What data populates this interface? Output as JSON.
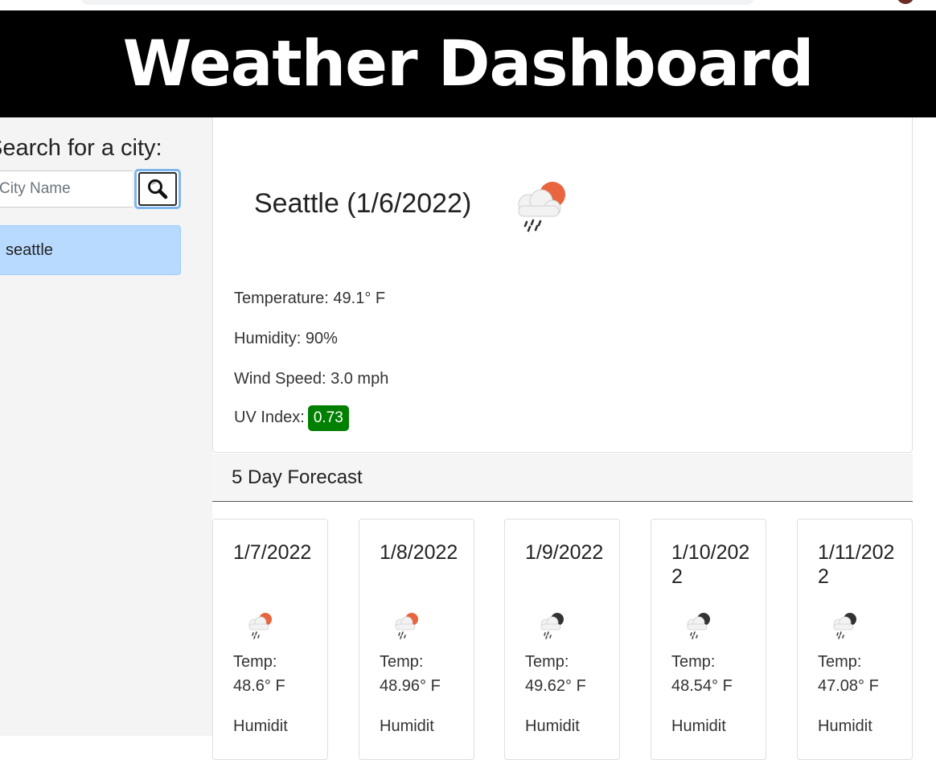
{
  "header": {
    "title": "Weather Dashboard"
  },
  "sidebar": {
    "search_title": "Search for a city:",
    "search_placeholder": "City Name",
    "search_icon": "magnifier-icon",
    "history": [
      "seattle"
    ]
  },
  "current": {
    "city_title": "Seattle (1/6/2022)",
    "icon": "rain-sun-icon",
    "temperature": "Temperature: 49.1° F",
    "humidity": "Humidity: 90%",
    "wind": "Wind Speed: 3.0 mph",
    "uv_label": "UV Index:",
    "uv_value": "0.73",
    "uv_color": "#008000"
  },
  "forecast": {
    "title": "5 Day Forecast",
    "temp_label": "Temp:",
    "humidity_label": "Humidit",
    "days": [
      {
        "date": "1/7/2022",
        "temp": "48.6° F",
        "icon": "rain-sun-icon"
      },
      {
        "date": "1/8/2022",
        "temp": "48.96° F",
        "icon": "rain-sun-icon"
      },
      {
        "date": "1/9/2022",
        "temp": "49.62° F",
        "icon": "rain-moon-icon"
      },
      {
        "date": "1/10/2022",
        "temp": "48.54° F",
        "icon": "rain-moon-icon"
      },
      {
        "date": "1/11/2022",
        "temp": "47.08° F",
        "icon": "rain-moon-icon"
      }
    ]
  },
  "colors": {
    "header_bg": "#000000",
    "history_bg": "#b8daff",
    "sun": "#e8653f",
    "moon": "#333333"
  }
}
